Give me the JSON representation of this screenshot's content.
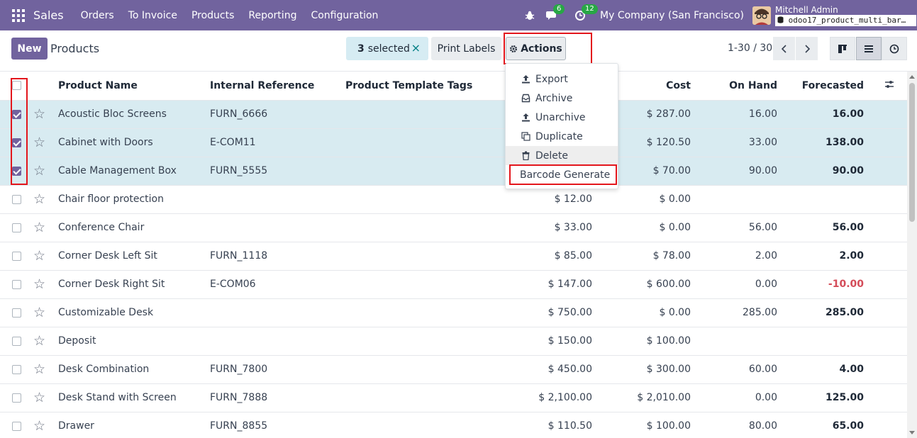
{
  "navbar": {
    "app_name": "Sales",
    "menu": [
      "Orders",
      "To Invoice",
      "Products",
      "Reporting",
      "Configuration"
    ],
    "messages_count": "6",
    "activities_count": "12",
    "company": "My Company (San Francisco)",
    "user_name": "Mitchell Admin",
    "database": "odoo17_product_multi_bar…"
  },
  "control_panel": {
    "new_label": "New",
    "title": "Products",
    "selected_count": "3",
    "selected_label": "selected",
    "clear_selection": "×",
    "print_labels": "Print Labels",
    "actions_label": "Actions",
    "pager": "1-30 / 30"
  },
  "actions_menu": [
    "Export",
    "Archive",
    "Unarchive",
    "Duplicate",
    "Delete",
    "Barcode Generate"
  ],
  "table": {
    "columns": {
      "name": "Product Name",
      "ref": "Internal Reference",
      "tags": "Product Template Tags",
      "cost": "Cost",
      "on_hand": "On Hand",
      "forecasted": "Forecasted"
    },
    "rows": [
      {
        "name": "Acoustic Bloc Screens",
        "ref": "FURN_6666",
        "price": "",
        "cost": "$ 287.00",
        "on_hand": "16.00",
        "forecasted": "16.00",
        "selected": true
      },
      {
        "name": "Cabinet with Doors",
        "ref": "E-COM11",
        "price": "",
        "cost": "$ 120.50",
        "on_hand": "33.00",
        "forecasted": "138.00",
        "selected": true
      },
      {
        "name": "Cable Management Box",
        "ref": "FURN_5555",
        "price": "",
        "cost": "$ 70.00",
        "on_hand": "90.00",
        "forecasted": "90.00",
        "selected": true
      },
      {
        "name": "Chair floor protection",
        "ref": "",
        "price": "$ 12.00",
        "cost": "$ 0.00",
        "on_hand": "",
        "forecasted": "",
        "selected": false
      },
      {
        "name": "Conference Chair",
        "ref": "",
        "price": "$ 33.00",
        "cost": "$ 0.00",
        "on_hand": "56.00",
        "forecasted": "56.00",
        "selected": false
      },
      {
        "name": "Corner Desk Left Sit",
        "ref": "FURN_1118",
        "price": "$ 85.00",
        "cost": "$ 78.00",
        "on_hand": "2.00",
        "forecasted": "2.00",
        "selected": false
      },
      {
        "name": "Corner Desk Right Sit",
        "ref": "E-COM06",
        "price": "$ 147.00",
        "cost": "$ 600.00",
        "on_hand": "0.00",
        "forecasted": "-10.00",
        "selected": false
      },
      {
        "name": "Customizable Desk",
        "ref": "",
        "price": "$ 750.00",
        "cost": "$ 0.00",
        "on_hand": "285.00",
        "forecasted": "285.00",
        "selected": false
      },
      {
        "name": "Deposit",
        "ref": "",
        "price": "$ 150.00",
        "cost": "$ 100.00",
        "on_hand": "",
        "forecasted": "",
        "selected": false
      },
      {
        "name": "Desk Combination",
        "ref": "FURN_7800",
        "price": "$ 450.00",
        "cost": "$ 300.00",
        "on_hand": "60.00",
        "forecasted": "4.00",
        "selected": false
      },
      {
        "name": "Desk Stand with Screen",
        "ref": "FURN_7888",
        "price": "$ 2,100.00",
        "cost": "$ 2,010.00",
        "on_hand": "0.00",
        "forecasted": "125.00",
        "selected": false
      },
      {
        "name": "Drawer",
        "ref": "FURN_8855",
        "price": "$ 110.50",
        "cost": "$ 100.00",
        "on_hand": "80.00",
        "forecasted": "65.00",
        "selected": false
      }
    ]
  },
  "colors": {
    "brand": "#71639e",
    "selected_row": "#d8ebf1",
    "negative": "#d44c59",
    "highlight": "#e3161c"
  }
}
